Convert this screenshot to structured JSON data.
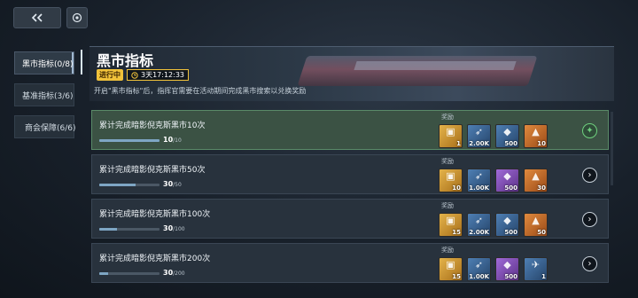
{
  "header": {
    "back_icon": "double-chevron-left-icon",
    "home_icon": "target-icon"
  },
  "sidebar": {
    "items": [
      {
        "label": "黑市指标(0/8)",
        "active": true
      },
      {
        "label": "基准指标(3/6)",
        "active": false
      },
      {
        "label": "商会保障(6/6)",
        "active": false,
        "icon": "check-circle-icon"
      }
    ]
  },
  "banner": {
    "title": "黑市指标",
    "status": "进行中",
    "timer_icon": "clock-icon",
    "timer": "3天17:12:33",
    "description": "开启\"黑市指标\"后，指挥官需要在活动期间完成黑市搜索以兑换奖励"
  },
  "tasks": [
    {
      "title": "累计完成暗影倪克斯黑市10次",
      "current": "10",
      "total": "/10",
      "progress": 1.0,
      "reward_label": "奖励",
      "rewards": [
        {
          "count": "1",
          "color": "gold",
          "icon": "crate-icon"
        },
        {
          "count": "2.00K",
          "color": "blue",
          "icon": "ship-icon"
        },
        {
          "count": "500",
          "color": "blue",
          "icon": "crystal-icon"
        },
        {
          "count": "10",
          "color": "orange",
          "icon": "ore-icon"
        }
      ],
      "action": "claim",
      "action_icon": "gift-icon"
    },
    {
      "title": "累计完成暗影倪克斯黑市50次",
      "current": "30",
      "total": "/50",
      "progress": 0.6,
      "reward_label": "奖励",
      "rewards": [
        {
          "count": "10",
          "color": "gold",
          "icon": "crate-icon"
        },
        {
          "count": "1.00K",
          "color": "blue",
          "icon": "ship-icon"
        },
        {
          "count": "500",
          "color": "purple",
          "icon": "crystal-icon"
        },
        {
          "count": "30",
          "color": "orange",
          "icon": "ore-icon"
        }
      ],
      "action": "go",
      "action_icon": "chevron-right-icon"
    },
    {
      "title": "累计完成暗影倪克斯黑市100次",
      "current": "30",
      "total": "/100",
      "progress": 0.3,
      "reward_label": "奖励",
      "rewards": [
        {
          "count": "15",
          "color": "gold",
          "icon": "crate-icon"
        },
        {
          "count": "2.00K",
          "color": "blue",
          "icon": "ship-icon"
        },
        {
          "count": "500",
          "color": "blue",
          "icon": "crystal-icon"
        },
        {
          "count": "50",
          "color": "orange",
          "icon": "ore-icon"
        }
      ],
      "action": "go",
      "action_icon": "chevron-right-icon"
    },
    {
      "title": "累计完成暗影倪克斯黑市200次",
      "current": "30",
      "total": "/200",
      "progress": 0.15,
      "reward_label": "奖励",
      "rewards": [
        {
          "count": "15",
          "color": "gold",
          "icon": "crate-icon"
        },
        {
          "count": "1.00K",
          "color": "blue",
          "icon": "ship-icon"
        },
        {
          "count": "500",
          "color": "purple",
          "icon": "crystal-icon"
        },
        {
          "count": "1",
          "color": "blue",
          "icon": "drone-icon"
        }
      ],
      "action": "go",
      "action_icon": "chevron-right-icon"
    }
  ]
}
